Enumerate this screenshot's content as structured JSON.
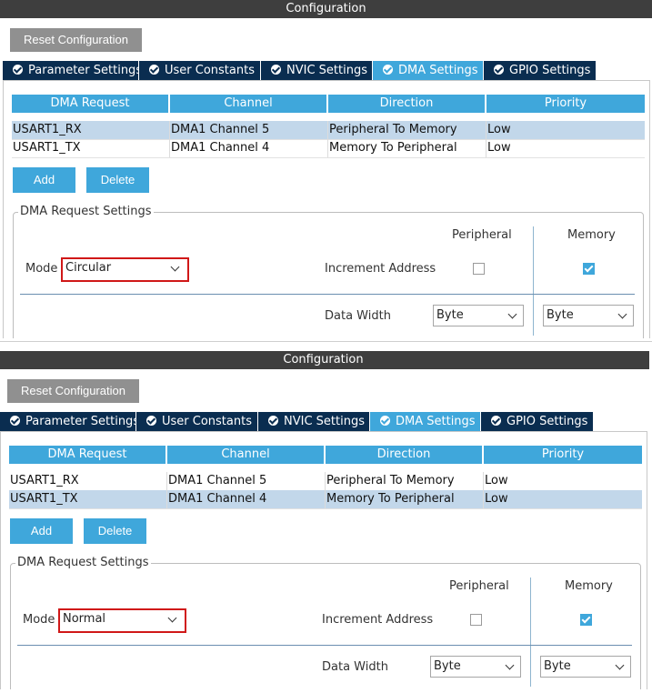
{
  "panels": [
    {
      "title": "Configuration",
      "reset_label": "Reset Configuration",
      "tabs": [
        {
          "label": "Parameter Settings"
        },
        {
          "label": "User Constants"
        },
        {
          "label": "NVIC Settings"
        },
        {
          "label": "DMA Settings"
        },
        {
          "label": "GPIO Settings"
        }
      ],
      "active_tab": "DMA Settings",
      "table": {
        "headers": [
          "DMA Request",
          "Channel",
          "Direction",
          "Priority"
        ],
        "rows": [
          [
            "USART1_RX",
            "DMA1 Channel 5",
            "Peripheral To Memory",
            "Low"
          ],
          [
            "USART1_TX",
            "DMA1 Channel 4",
            "Memory To Peripheral",
            "Low"
          ]
        ],
        "selected_row": 0
      },
      "add_label": "Add",
      "delete_label": "Delete",
      "settings": {
        "legend": "DMA Request Settings",
        "col_peripheral": "Peripheral",
        "col_memory": "Memory",
        "mode_label": "Mode",
        "mode_value": "Circular",
        "increment_label": "Increment Address",
        "increment_peripheral": false,
        "increment_memory": true,
        "data_width_label": "Data Width",
        "data_width_peripheral": "Byte",
        "data_width_memory": "Byte"
      }
    },
    {
      "title": "Configuration",
      "reset_label": "Reset Configuration",
      "tabs": [
        {
          "label": "Parameter Settings"
        },
        {
          "label": "User Constants"
        },
        {
          "label": "NVIC Settings"
        },
        {
          "label": "DMA Settings"
        },
        {
          "label": "GPIO Settings"
        }
      ],
      "active_tab": "DMA Settings",
      "table": {
        "headers": [
          "DMA Request",
          "Channel",
          "Direction",
          "Priority"
        ],
        "rows": [
          [
            "USART1_RX",
            "DMA1 Channel 5",
            "Peripheral To Memory",
            "Low"
          ],
          [
            "USART1_TX",
            "DMA1 Channel 4",
            "Memory To Peripheral",
            "Low"
          ]
        ],
        "selected_row": 1
      },
      "add_label": "Add",
      "delete_label": "Delete",
      "settings": {
        "legend": "DMA Request Settings",
        "col_peripheral": "Peripheral",
        "col_memory": "Memory",
        "mode_label": "Mode",
        "mode_value": "Normal",
        "increment_label": "Increment Address",
        "increment_peripheral": false,
        "increment_memory": true,
        "data_width_label": "Data Width",
        "data_width_peripheral": "Byte",
        "data_width_memory": "Byte"
      }
    }
  ],
  "colors": {
    "title_bar": "#3e3e3e",
    "tab_inactive": "#0a2d50",
    "tab_active": "#3fa7db",
    "accent": "#3fa7db",
    "selected_row": "#c2d7ea",
    "mode_highlight": "#d01818",
    "reset_button": "#909090"
  }
}
